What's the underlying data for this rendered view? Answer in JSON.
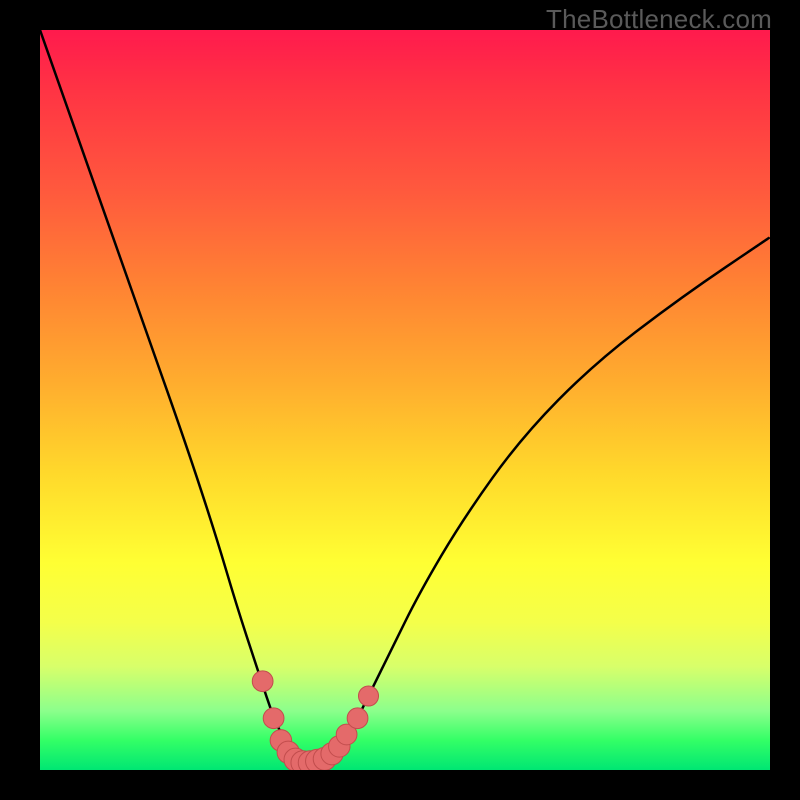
{
  "watermark": "TheBottleneck.com",
  "colors": {
    "background": "#000000",
    "curve": "#000000",
    "marker_fill": "#e46a6a",
    "marker_stroke": "#c24d4d"
  },
  "chart_data": {
    "type": "line",
    "title": "",
    "xlabel": "",
    "ylabel": "",
    "xlim": [
      0,
      100
    ],
    "ylim": [
      0,
      100
    ],
    "series": [
      {
        "name": "bottleneck-curve",
        "x": [
          0,
          5,
          10,
          15,
          20,
          24,
          27,
          30,
          32,
          34,
          35,
          36,
          37,
          39,
          41,
          43,
          45,
          48,
          52,
          58,
          66,
          76,
          88,
          100
        ],
        "values": [
          100,
          86,
          72,
          58,
          44,
          32,
          22,
          13,
          7,
          3,
          1.5,
          1,
          1,
          1.5,
          3,
          6,
          10,
          16,
          24,
          34,
          45,
          55,
          64,
          72
        ]
      }
    ],
    "markers": [
      {
        "x": 30.5,
        "y": 12,
        "r": 1.2
      },
      {
        "x": 32.0,
        "y": 7,
        "r": 1.2
      },
      {
        "x": 33.0,
        "y": 4,
        "r": 1.3
      },
      {
        "x": 34.0,
        "y": 2.4,
        "r": 1.4
      },
      {
        "x": 35.0,
        "y": 1.4,
        "r": 1.5
      },
      {
        "x": 36.0,
        "y": 1.0,
        "r": 1.6
      },
      {
        "x": 37.0,
        "y": 1.0,
        "r": 1.6
      },
      {
        "x": 38.0,
        "y": 1.2,
        "r": 1.6
      },
      {
        "x": 39.0,
        "y": 1.5,
        "r": 1.5
      },
      {
        "x": 40.0,
        "y": 2.2,
        "r": 1.4
      },
      {
        "x": 41.0,
        "y": 3.2,
        "r": 1.3
      },
      {
        "x": 42.0,
        "y": 4.8,
        "r": 1.2
      },
      {
        "x": 43.5,
        "y": 7.0,
        "r": 1.2
      },
      {
        "x": 45.0,
        "y": 10.0,
        "r": 1.1
      }
    ]
  }
}
